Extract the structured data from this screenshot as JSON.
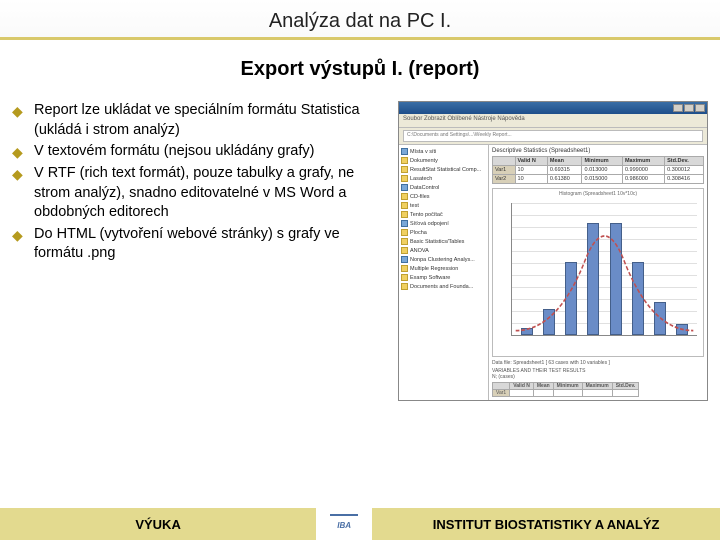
{
  "title": "Analýza dat na PC I.",
  "subtitle": "Export výstupů I. (report)",
  "bullets": [
    "Report lze ukládat ve speciálním formátu Statistica (ukládá i strom analýz)",
    "V textovém formátu (nejsou ukládány grafy)",
    "V RTF (rich text formát), pouze tabulky a grafy, ne strom analýz), snadno editovatelné v MS Word a obdobných editorech",
    "Do HTML (vytvoření webové stránky) s grafy ve formátu .png"
  ],
  "window": {
    "toolbar": "Soubor   Zobrazit   Oblíbené   Nástroje   Nápověda",
    "address": "C:\\Documents and Settings\\...\\Weekly Report...",
    "tree_items": [
      "Místa v síti",
      "Dokumenty",
      "ResultStat Statistical Comp...",
      "Lasatech",
      "DataControl",
      "CD-files",
      "test",
      "Tento počítač",
      "Síťová odpojení",
      "Plocha",
      "Basic Statistics/Tables",
      "ANOVA",
      "Nonpa Clustering Analys...",
      "Multiple Regression",
      "Examp Software",
      "Documents and Founda..."
    ],
    "stats_title": "Descriptive Statistics (Spreadsheet1)",
    "table": {
      "headers": [
        "",
        "Valid N",
        "Mean",
        "Minimum",
        "Maximum",
        "Std.Dev."
      ],
      "rows": [
        [
          "Var1",
          "10",
          "0.69315",
          "0.013000",
          "0.999000",
          "0.300012"
        ],
        [
          "Var2",
          "10",
          "0.61380",
          "0.015000",
          "0.986000",
          "0.308416"
        ]
      ]
    },
    "hist_title": "Histogram (Spreadsheet1 10v*10c)",
    "below_lines": [
      "Data file: Spreadsheet1 [ 63 cases with 10 variables ]",
      "VARIABLES AND THEIR TEST RESULTS",
      "N;   (cases)"
    ],
    "table2": {
      "headers": [
        "",
        "Valid N",
        "Mean",
        "Minimum",
        "Maximum",
        "Std.Dev."
      ],
      "row": [
        "Var1",
        "",
        "",
        "",
        "",
        ""
      ]
    }
  },
  "chart_data": {
    "type": "bar",
    "categories": [
      "",
      "",
      "",
      "",
      "",
      "",
      "",
      ""
    ],
    "values": [
      5,
      20,
      55,
      85,
      85,
      55,
      25,
      8
    ],
    "title": "Histogram (Spreadsheet1 10v*10c)",
    "xlabel": "",
    "ylabel": "",
    "ylim": [
      0,
      100
    ],
    "overlay": "normal-curve"
  },
  "footer": {
    "left": "VÝUKA",
    "logo": "IBA",
    "right": "INSTITUT BIOSTATISTIKY A ANALÝZ"
  }
}
